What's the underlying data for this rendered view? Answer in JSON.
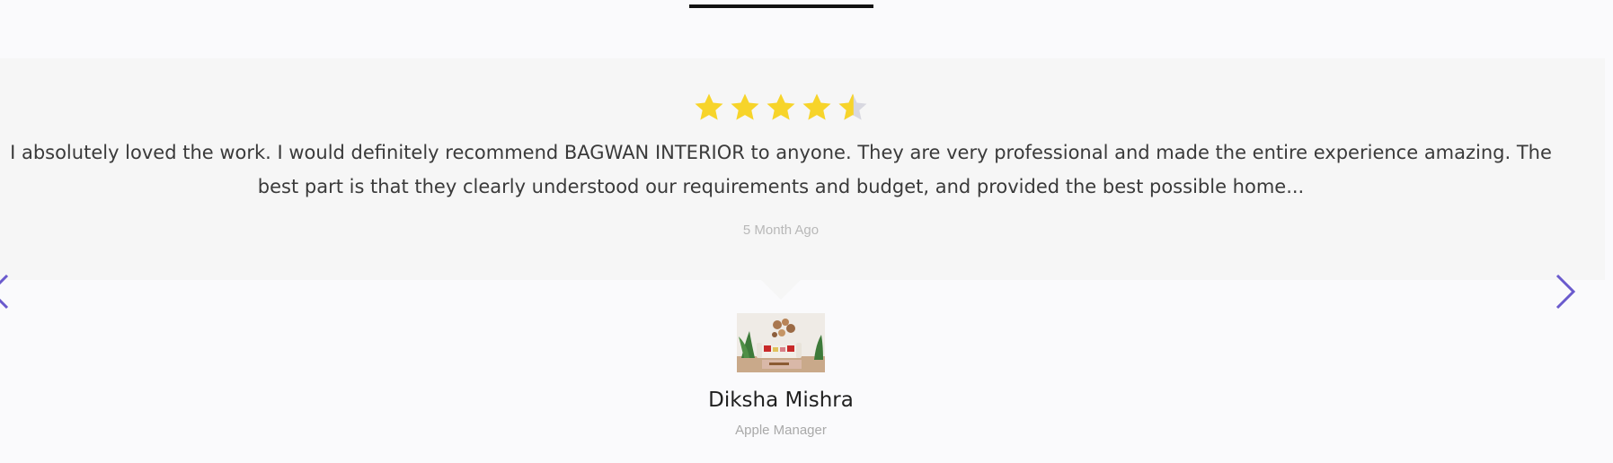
{
  "testimonial": {
    "rating": 4.5,
    "rating_max": 5,
    "star_color": "#f7d42a",
    "star_empty_color": "#d8d8e0",
    "text": "I absolutely loved the work. I would definitely recommend BAGWAN INTERIOR to anyone. They are very professional and made the entire experience amazing. The best part is that they clearly understood our requirements and budget, and provided the best possible home...",
    "time_ago": "5 Month Ago",
    "reviewer": {
      "name": "Diksha Mishra",
      "role": "Apple Manager",
      "avatar": "living-room-photo"
    }
  },
  "navigation": {
    "prev_icon": "chevron-left-icon",
    "next_icon": "chevron-right-icon",
    "arrow_color": "#6a5acd"
  }
}
